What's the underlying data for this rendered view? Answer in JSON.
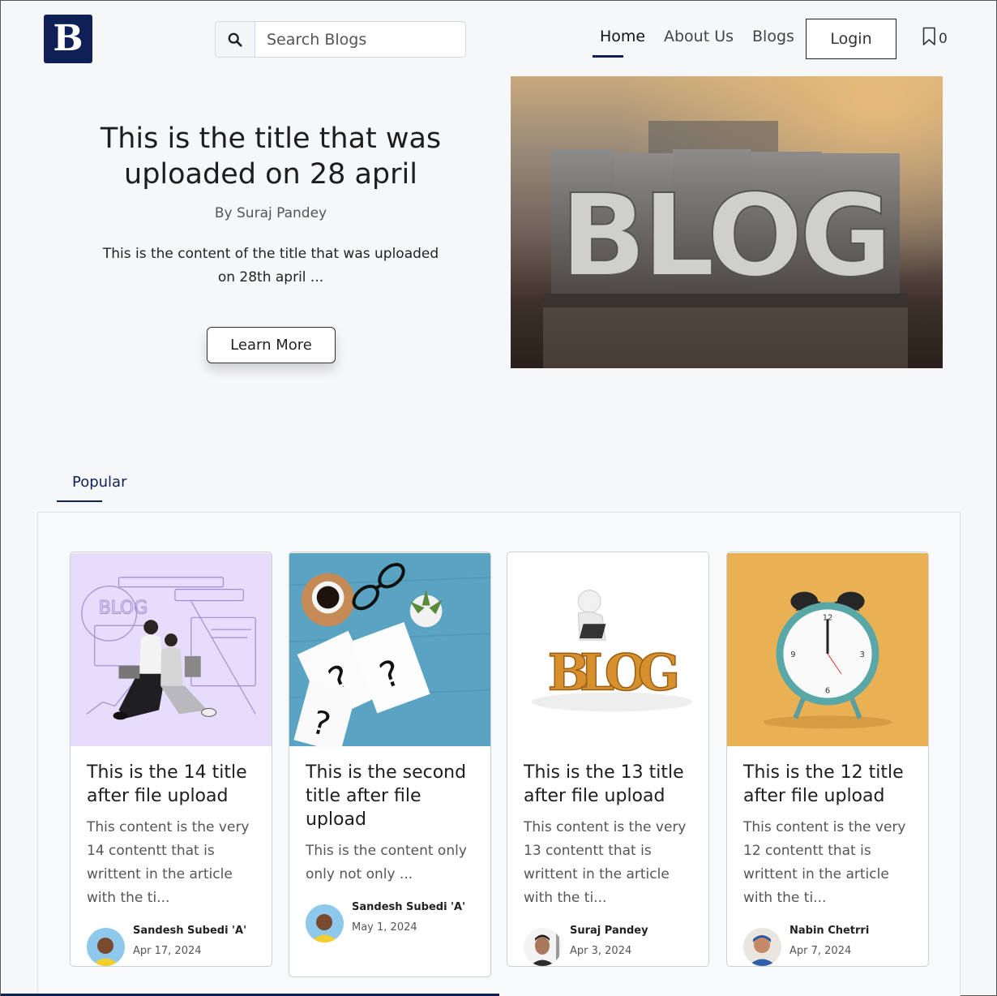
{
  "logo": {
    "letter": "B"
  },
  "search": {
    "placeholder": "Search Blogs"
  },
  "nav": [
    {
      "label": "Home",
      "active": true
    },
    {
      "label": "About Us",
      "active": false
    },
    {
      "label": "Blogs",
      "active": false
    }
  ],
  "login_label": "Login",
  "bookmark": {
    "count": "0",
    "icon": "bookmark-icon"
  },
  "hero": {
    "title": "This is the title that was uploaded on 28 april",
    "author": "By Suraj Pandey",
    "excerpt": "This is the content of the title that was uploaded on 28th april ...",
    "button": "Learn More",
    "image_text": "BLOG"
  },
  "popular_tab": "Popular",
  "cards": [
    {
      "title": "This is the 14 title after file upload",
      "excerpt": "This content is the very 14 contentt that is writtent in the article with the ti...",
      "author": "Sandesh Subedi 'A'",
      "date": "Apr 17, 2024",
      "thumb_text": "BLOG"
    },
    {
      "title": "This is the second title after file upload",
      "excerpt": "This is the content only only not only ...",
      "author": "Sandesh Subedi 'A'",
      "date": "May 1, 2024"
    },
    {
      "title": "This is the 13 title after file upload",
      "excerpt": "This content is the very 13 contentt that is writtent in the article with the ti...",
      "author": "Suraj Pandey",
      "date": "Apr 3, 2024",
      "thumb_text": "BLOG"
    },
    {
      "title": "This is the 12 title after file upload",
      "excerpt": "This content is the very 12 contentt that is writtent in the article with the ti...",
      "author": "Nabin Chetrri",
      "date": "Apr 7, 2024"
    }
  ],
  "colors": {
    "brand": "#0f2057",
    "page_bg": "#f6f7f9"
  }
}
